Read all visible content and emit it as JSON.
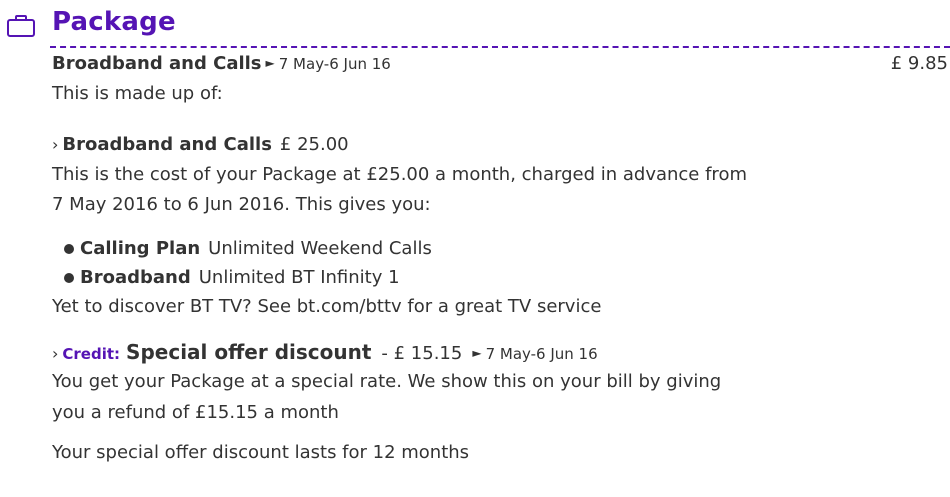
{
  "header": {
    "title": "Package",
    "icon": "briefcase-icon",
    "accent_color": "#5514b4"
  },
  "summary": {
    "name": "Broadband and Calls",
    "period": "7 May-6 Jun 16",
    "amount": "£ 9.85",
    "made_up_text": "This is made up of:"
  },
  "items": [
    {
      "name": "Broadband and Calls",
      "amount": "£ 25.00",
      "description_line1": "This is the cost of your Package at £25.00 a month, charged in advance from",
      "description_line2": "7 May 2016 to 6 Jun 2016. This gives you:",
      "features": [
        {
          "label": "Calling Plan",
          "value": "Unlimited Weekend Calls"
        },
        {
          "label": "Broadband",
          "value": "Unlimited BT Infinity 1"
        }
      ],
      "note": "Yet to discover BT TV? See bt.com/bttv for a great TV service"
    },
    {
      "credit_label": "Credit:",
      "name": "Special offer discount",
      "amount": "- £ 15.15",
      "period": "7 May-6 Jun 16",
      "description_line1": "You get your Package at a special rate. We show this on your bill by giving",
      "description_line2": "you a refund of £15.15 a month",
      "note": "Your special offer discount lasts for 12 months"
    }
  ]
}
